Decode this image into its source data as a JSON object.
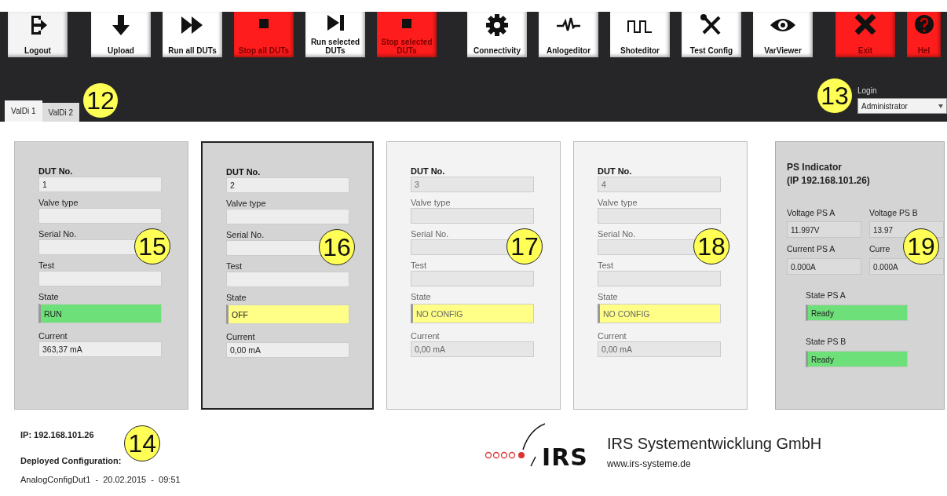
{
  "toolbar": [
    {
      "label": "Logout",
      "color": "#f4f4f4"
    },
    {
      "label": "Upload",
      "color": "#ffffff"
    },
    {
      "label": "Run all DUTs",
      "color": "#ffffff"
    },
    {
      "label": "Stop all DUTs",
      "color": "#ff1c1c"
    },
    {
      "label": "Run selected DUTs",
      "color": "#ffffff"
    },
    {
      "label": "Stop selected DUTs",
      "color": "#ff1c1c"
    },
    {
      "label": "Connectivity",
      "color": "#ffffff"
    },
    {
      "label": "Anlogeditor",
      "color": "#ffffff"
    },
    {
      "label": "Shoteditor",
      "color": "#ffffff"
    },
    {
      "label": "Test Config",
      "color": "#ffffff"
    },
    {
      "label": "VarViewer",
      "color": "#ffffff"
    },
    {
      "label": "Exit",
      "color": "#ff1c1c"
    },
    {
      "label": "Hel",
      "color": "#ff1c1c"
    }
  ],
  "tabs": [
    {
      "label": "ValDi 1",
      "selected": true
    },
    {
      "label": "ValDi 2",
      "selected": false
    }
  ],
  "tabs_callout": "12",
  "login": {
    "label": "Login",
    "value": "Administrator",
    "callout": "13"
  },
  "dut_panels": [
    {
      "selected": false,
      "disabled": false,
      "callout": "15",
      "fields": [
        {
          "label": "DUT No.",
          "kind": "title",
          "value": "1"
        },
        {
          "label": "Valve type",
          "kind": "text"
        },
        {
          "label": "Serial No.",
          "kind": "text"
        },
        {
          "label": "Test",
          "kind": "text"
        },
        {
          "label": "State",
          "kind": "state",
          "value": "RUN",
          "color": "#6ee07a"
        },
        {
          "label": "Current",
          "kind": "text",
          "value": "363,37 mA"
        }
      ]
    },
    {
      "selected": true,
      "disabled": false,
      "callout": "16",
      "fields": [
        {
          "label": "DUT No.",
          "kind": "title",
          "value": "2"
        },
        {
          "label": "Valve type",
          "kind": "text"
        },
        {
          "label": "Serial No.",
          "kind": "text"
        },
        {
          "label": "Test",
          "kind": "text"
        },
        {
          "label": "State",
          "kind": "state",
          "value": "OFF",
          "color": "#ffff88"
        },
        {
          "label": "Current",
          "kind": "text",
          "value": "0,00 mA"
        }
      ]
    },
    {
      "selected": false,
      "disabled": true,
      "callout": "17",
      "fields": [
        {
          "label": "DUT No.",
          "kind": "title",
          "value": "3"
        },
        {
          "label": "Valve type",
          "kind": "text"
        },
        {
          "label": "Serial No.",
          "kind": "text"
        },
        {
          "label": "Test",
          "kind": "text"
        },
        {
          "label": "State",
          "kind": "state",
          "value": "NO CONFIG",
          "color": "#ffff88"
        },
        {
          "label": "Current",
          "kind": "text",
          "value": "0,00 mA"
        }
      ]
    },
    {
      "selected": false,
      "disabled": true,
      "callout": "18",
      "fields": [
        {
          "label": "DUT No.",
          "kind": "title",
          "value": "4"
        },
        {
          "label": "Valve type",
          "kind": "text"
        },
        {
          "label": "Serial No.",
          "kind": "text"
        },
        {
          "label": "Test",
          "kind": "text"
        },
        {
          "label": "State",
          "kind": "state",
          "value": "NO CONFIG",
          "color": "#ffff88"
        },
        {
          "label": "Current",
          "kind": "text",
          "value": "0,00 mA"
        }
      ]
    }
  ],
  "ps_panel": {
    "title": "PS Indicator",
    "subtitle": "(IP 192.168.101.26)",
    "callout": "19",
    "readings": [
      {
        "label": "Voltage PS A",
        "value": "11.997V"
      },
      {
        "label": "Voltage PS B",
        "value": "13.97"
      },
      {
        "label": "Current PS A",
        "value": "0.000A"
      },
      {
        "label": "Curre",
        "value": "0.000A"
      }
    ],
    "states": [
      {
        "label": "State PS A",
        "value": "Ready",
        "color": "#6ee07a"
      },
      {
        "label": "State PS B",
        "value": "Ready",
        "color": "#6ee07a"
      }
    ]
  },
  "footer": {
    "ip": "IP: 192.168.101.26",
    "deployed_label": "Deployed Configuration:",
    "callout": "14",
    "config": "AnalogConfigDut1  -  20.02.2015  -  09:51"
  },
  "logo": {
    "mark": "IRS",
    "company": "IRS Systementwicklung GmbH",
    "url": "www.irs-systeme.de"
  }
}
